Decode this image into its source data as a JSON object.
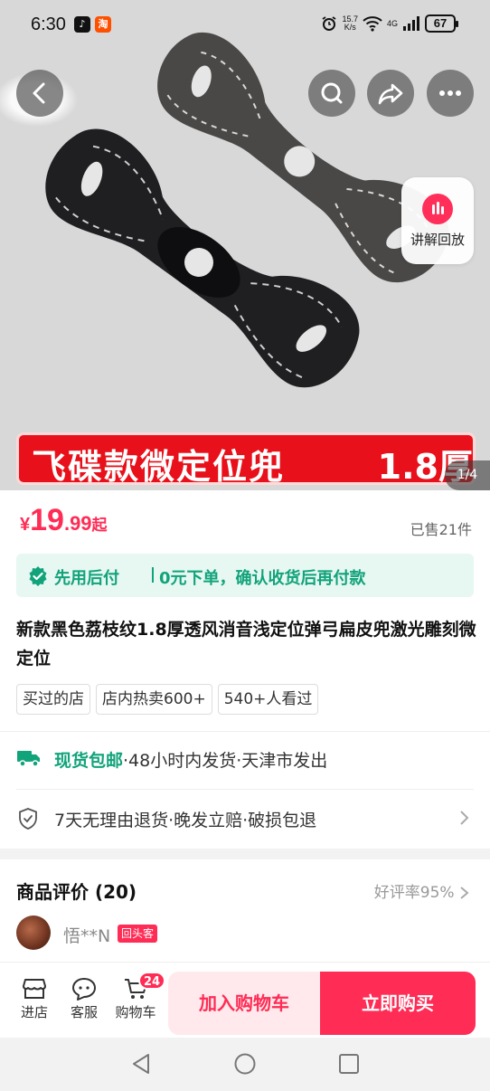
{
  "status_bar": {
    "time": "6:30",
    "net_speed_value": "15.7",
    "net_speed_unit": "K/s",
    "signal_label": "4G",
    "battery": "67"
  },
  "hero": {
    "banner_title": "飞碟款微定位兜",
    "banner_spec": "1.8厚",
    "image_counter": "1/4",
    "replay_label": "讲解回放"
  },
  "price": {
    "currency": "¥",
    "integer": "19",
    "decimal": ".99",
    "suffix": "起",
    "sold": "已售21件"
  },
  "pay_later": {
    "title": "先用后付",
    "desc": "0元下单，确认收货后再付款"
  },
  "product": {
    "title": "新款黑色荔枝纹1.8厚透风消音浅定位弹弓扁皮兜激光雕刻微定位",
    "tags": [
      "买过的店",
      "店内热卖600+",
      "540+人看过"
    ]
  },
  "services": {
    "shipping_highlight": "现货包邮",
    "shipping_rest": "·48小时内发货·天津市发出",
    "guarantee": "7天无理由退货·晚发立赔·破损包退"
  },
  "reviews": {
    "heading": "商品评价 (20)",
    "rate": "好评率95%",
    "reviewer": "悟**N",
    "badge": "回头客"
  },
  "bottom_bar": {
    "store": "进店",
    "service": "客服",
    "cart": "购物车",
    "cart_count": "24",
    "add_to_cart": "加入购物车",
    "buy_now": "立即购买"
  },
  "colors": {
    "brand_red": "#ff2c55",
    "pay_later_green": "#11a37a",
    "banner_red": "#e8101a"
  }
}
